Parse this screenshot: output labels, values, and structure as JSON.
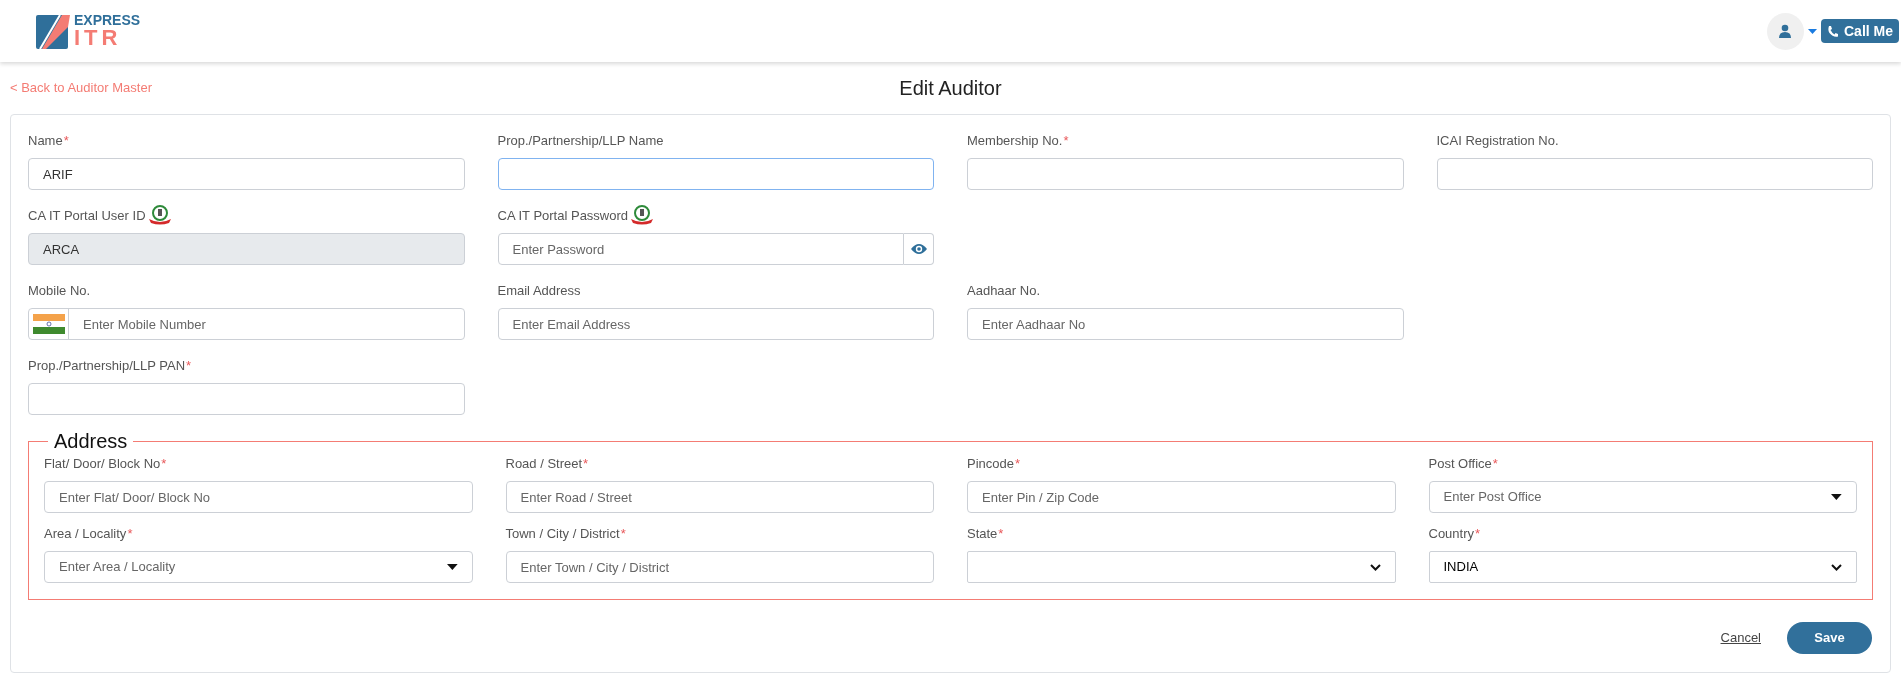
{
  "header": {
    "logo": {
      "top": "EXPRESS",
      "bottom": "ITR"
    },
    "call_button": "Call Me"
  },
  "back_link": "< Back to Auditor Master",
  "title": "Edit Auditor",
  "rows": [
    [
      {
        "kind": "text",
        "label": "Name",
        "required_mark": "*",
        "value": "ARIF",
        "disabled": false,
        "focused": false
      },
      {
        "kind": "text",
        "label": "Prop./Partnership/LLP Name",
        "disabled": false,
        "focused": true
      },
      {
        "kind": "text",
        "label": "Membership No.",
        "required_mark": "*",
        "disabled": false,
        "focused": false
      },
      {
        "kind": "text",
        "label": "ICAI Registration No.",
        "disabled": false,
        "focused": false
      }
    ],
    [
      {
        "kind": "text",
        "label": "CA IT Portal User ID",
        "value": "ARCA",
        "disabled": true,
        "focused": false,
        "emblem": true
      },
      {
        "kind": "password",
        "label": "CA IT Portal Password",
        "placeholder": "Enter Password",
        "disabled": false,
        "focused": false,
        "emblem": true
      }
    ],
    [
      {
        "kind": "phone",
        "label": "Mobile No.",
        "placeholder": "Enter Mobile Number",
        "disabled": false,
        "focused": false
      },
      {
        "kind": "text",
        "label": "Email Address",
        "placeholder": "Enter Email Address",
        "disabled": false,
        "focused": false
      },
      {
        "kind": "text",
        "label": "Aadhaar No.",
        "placeholder": "Enter Aadhaar No",
        "disabled": false,
        "focused": false
      }
    ],
    [
      {
        "kind": "text",
        "label": "Prop./Partnership/LLP PAN",
        "required_mark": "*",
        "disabled": false,
        "focused": false
      }
    ]
  ],
  "address": {
    "legend": "Address",
    "rows": [
      [
        {
          "kind": "text",
          "label": "Flat/ Door/ Block No",
          "required_mark": "*",
          "placeholder": "Enter Flat/ Door/ Block No"
        },
        {
          "kind": "text",
          "label": "Road / Street",
          "required_mark": "*",
          "placeholder": "Enter Road / Street"
        },
        {
          "kind": "text",
          "label": "Pincode",
          "required_mark": "*",
          "placeholder": "Enter Pin / Zip Code"
        },
        {
          "kind": "combo",
          "label": "Post Office",
          "required_mark": "*",
          "placeholder": "Enter Post Office"
        }
      ],
      [
        {
          "kind": "combo",
          "label": "Area / Locality",
          "required_mark": "*",
          "placeholder": "Enter Area / Locality"
        },
        {
          "kind": "text",
          "label": "Town / City / District",
          "required_mark": "*",
          "placeholder": "Enter Town / City / District"
        },
        {
          "kind": "select",
          "label": "State",
          "required_mark": "*"
        },
        {
          "kind": "select",
          "label": "Country",
          "required_mark": "*",
          "value": "INDIA"
        }
      ]
    ]
  },
  "actions": {
    "cancel": "Cancel",
    "save": "Save"
  }
}
